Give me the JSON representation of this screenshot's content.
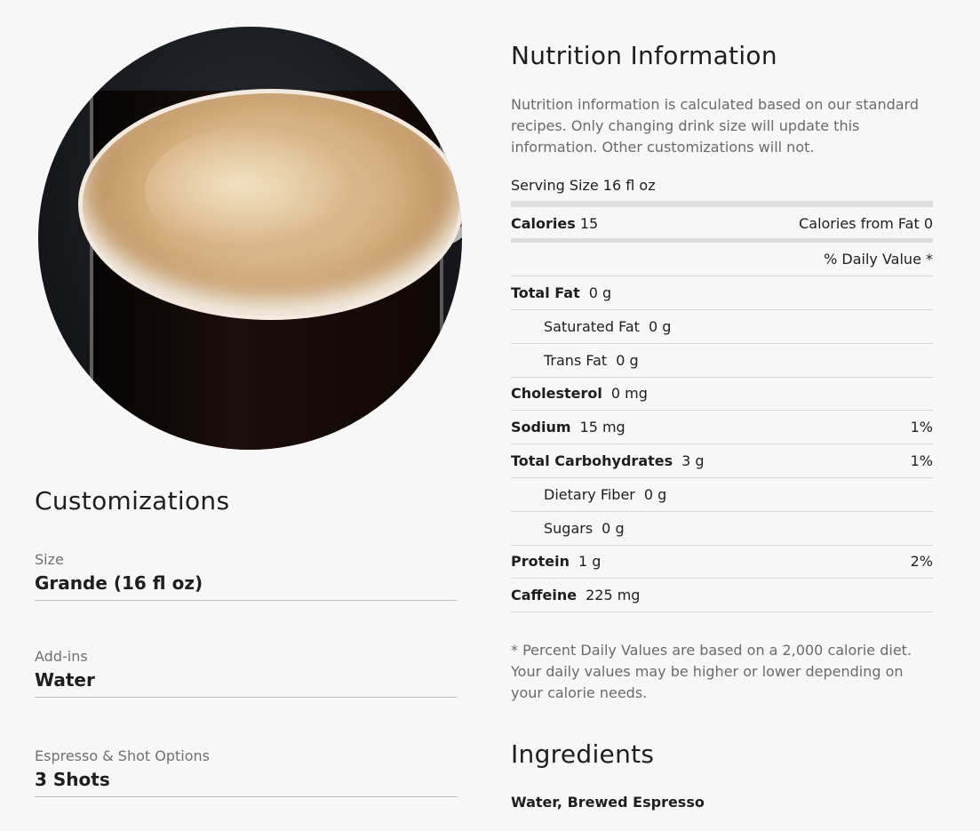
{
  "customizations": {
    "title": "Customizations",
    "items": [
      {
        "label": "Size",
        "value": "Grande (16 fl oz)"
      },
      {
        "label": "Add-ins",
        "value": "Water"
      },
      {
        "label": "Espresso & Shot Options",
        "value": "3 Shots"
      }
    ]
  },
  "nutrition": {
    "title": "Nutrition Information",
    "description": "Nutrition information is calculated based on our standard recipes. Only changing drink size will update this information. Other customizations will not.",
    "serving": "Serving Size 16 fl oz",
    "calories_label": "Calories",
    "calories_value": "15",
    "calories_from_fat": "Calories from Fat 0",
    "daily_value_header": "% Daily Value *",
    "rows": [
      {
        "name": "Total Fat",
        "amount": "0 g",
        "dv": "",
        "sub": false
      },
      {
        "name": "Saturated Fat",
        "amount": "0 g",
        "dv": "",
        "sub": true
      },
      {
        "name": "Trans Fat",
        "amount": "0 g",
        "dv": "",
        "sub": true
      },
      {
        "name": "Cholesterol",
        "amount": "0 mg",
        "dv": "",
        "sub": false
      },
      {
        "name": "Sodium",
        "amount": "15 mg",
        "dv": "1%",
        "sub": false
      },
      {
        "name": "Total Carbohydrates",
        "amount": "3 g",
        "dv": "1%",
        "sub": false
      },
      {
        "name": "Dietary Fiber",
        "amount": "0 g",
        "dv": "",
        "sub": true
      },
      {
        "name": "Sugars",
        "amount": "0 g",
        "dv": "",
        "sub": true
      },
      {
        "name": "Protein",
        "amount": "1 g",
        "dv": "2%",
        "sub": false
      },
      {
        "name": "Caffeine",
        "amount": "225 mg",
        "dv": "",
        "sub": false
      }
    ],
    "footnote": "* Percent Daily Values are based on a 2,000 calorie diet. Your daily values may be higher or lower depending on your calorie needs."
  },
  "ingredients": {
    "title": "Ingredients",
    "text": "Water, Brewed Espresso"
  }
}
